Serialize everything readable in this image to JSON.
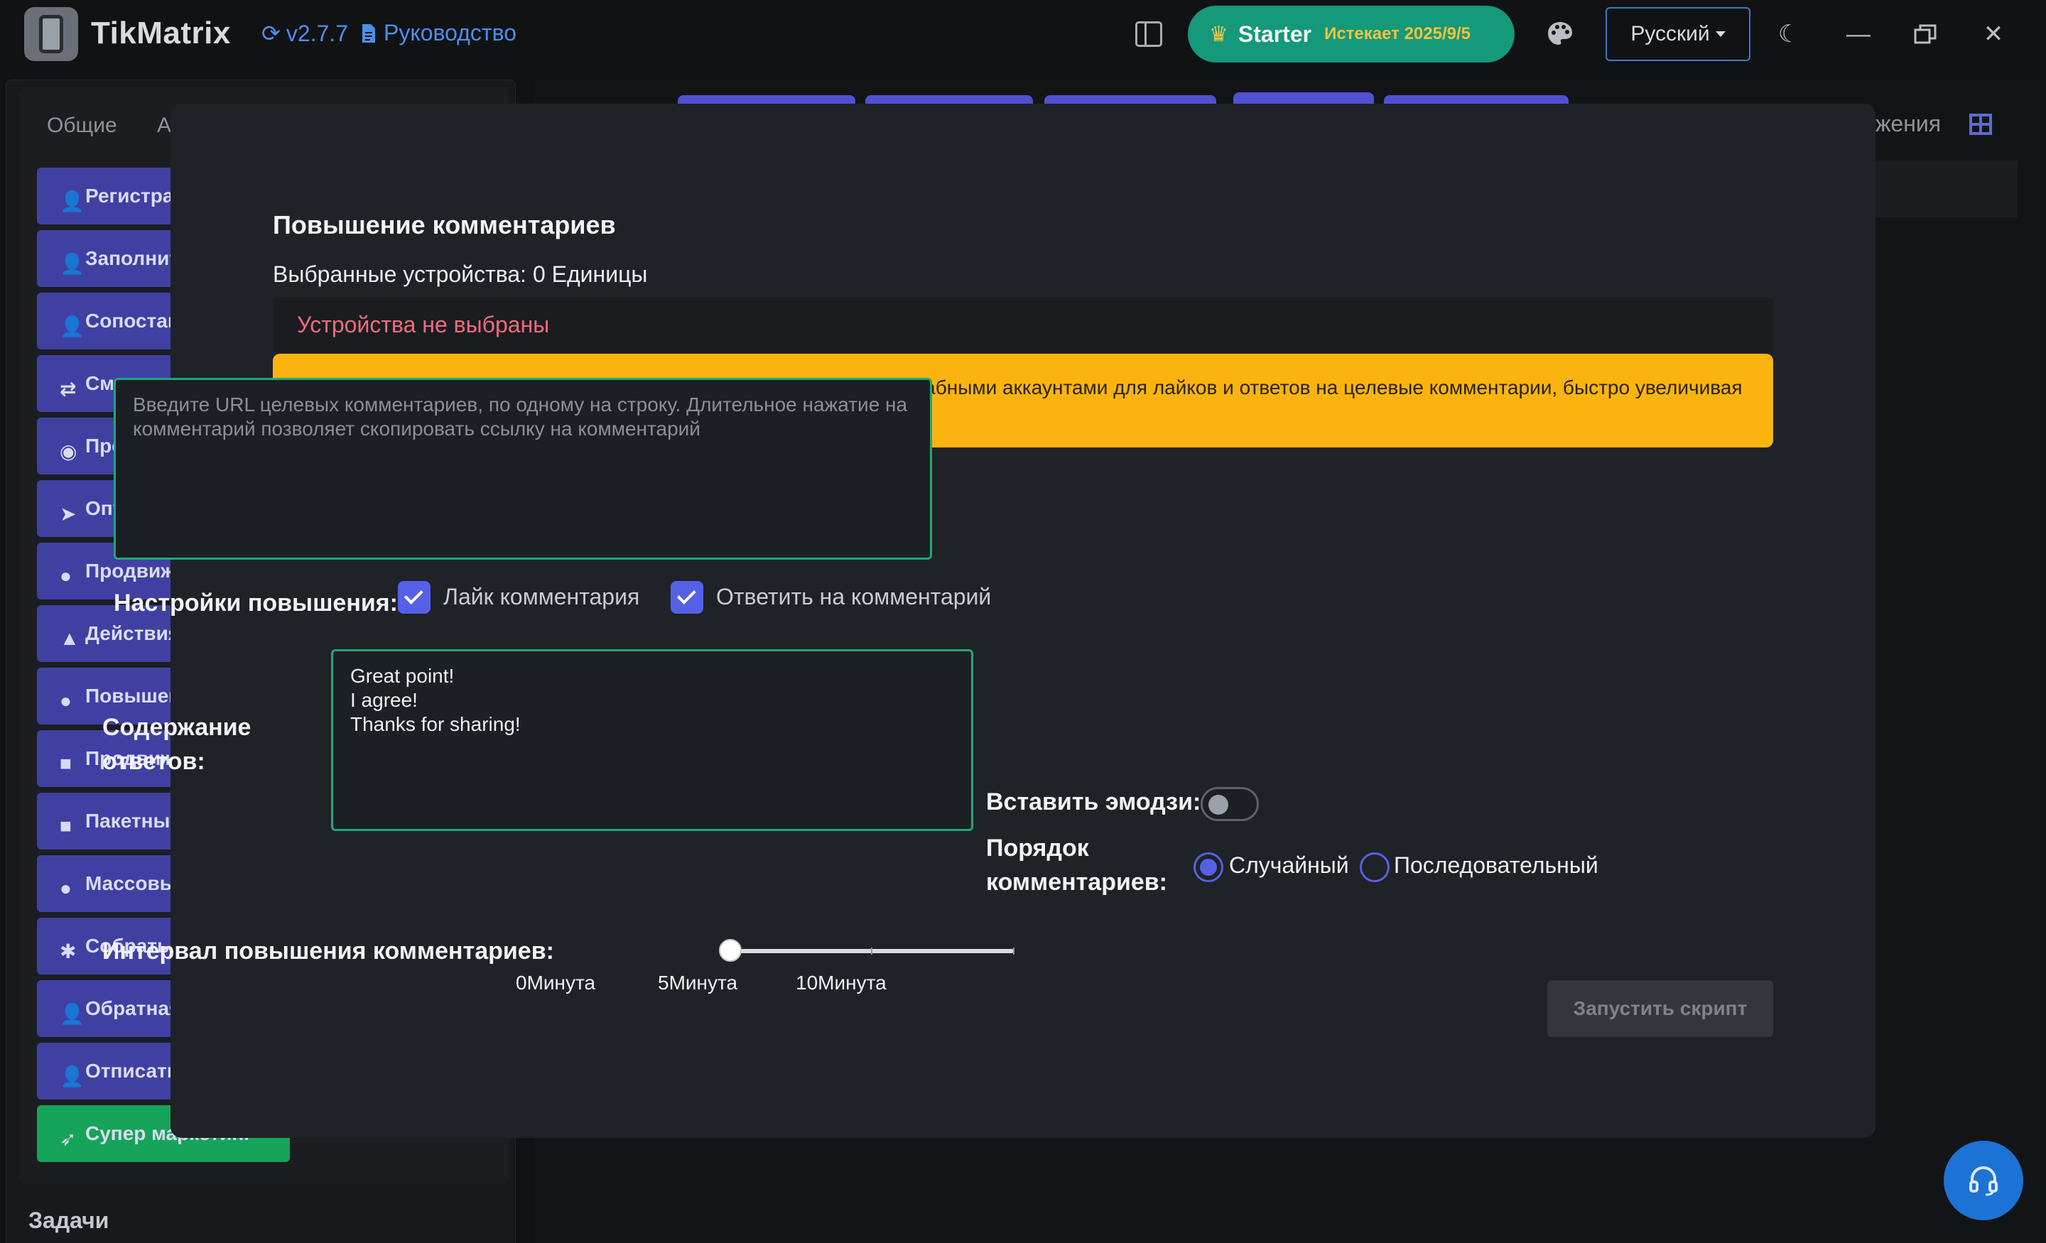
{
  "titlebar": {
    "app_name": "TikMatrix",
    "version": "v2.7.7",
    "guide_link": "Руководство",
    "plan_name": "Starter",
    "plan_expiry": "Истекает 2025/9/5",
    "language": "Русский",
    "accent_color": "#14997a"
  },
  "left_panel": {
    "tabs": [
      "Общие",
      "AD"
    ],
    "menu_items": [
      {
        "label": "Регистрация",
        "icon": "user-plus-icon"
      },
      {
        "label": "Заполнить профиль",
        "icon": "user-plus-icon"
      },
      {
        "label": "Сопоставить",
        "icon": "user-plus-icon"
      },
      {
        "label": "Сменить",
        "icon": "swap-icon"
      },
      {
        "label": "Прогрев",
        "icon": "eye-icon"
      },
      {
        "label": "Опубликовать",
        "icon": "send-icon"
      },
      {
        "label": "Продвижение",
        "icon": "user-icon"
      },
      {
        "label": "Действия",
        "icon": "thumbs-up-icon"
      },
      {
        "label": "Повышение",
        "icon": "comment-icon"
      },
      {
        "label": "Продвижение",
        "icon": "video-icon"
      },
      {
        "label": "Пакетные",
        "icon": "message-icon"
      },
      {
        "label": "Массовые",
        "icon": "comment-icon"
      },
      {
        "label": "Собрать",
        "icon": "spider-icon"
      },
      {
        "label": "Обратная",
        "icon": "user-plus-icon"
      },
      {
        "label": "Отписаться",
        "icon": "user-minus-icon"
      },
      {
        "label": "Супер маркетинг",
        "icon": "rocket-icon"
      }
    ],
    "tasks_title": "Задачи"
  },
  "right_panel": {
    "partial_label": "жения"
  },
  "modal": {
    "title": "Повышение комментариев",
    "selected_devices": "Выбранные устройства: 0 Единицы",
    "no_devices": "Устройства не выбраны",
    "warning_text": "Функция повышения комментариев позволяет управлять масштабными аккаунтами для лайков и ответов на целевые комментарии, быстро увеличивая взаимодействие и вовлеченность для целевых комментариев.",
    "url_placeholder": "Введите URL целевых комментариев, по одному на строку. Длительное нажатие на комментарий позволяет скопировать ссылку на комментарий",
    "settings_label": "Настройки повышения:",
    "like_label": "Лайк комментария",
    "like_checked": true,
    "reply_label": "Ответить на комментарий",
    "reply_checked": true,
    "reply_content_label": "Содержание ответов:",
    "reply_content": "Great point!\nI agree!\nThanks for sharing!",
    "emoji_label": "Вставить эмодзи:",
    "emoji_enabled": false,
    "order_label": "Порядок комментариев:",
    "order_random": "Случайный",
    "order_sequential": "Последовательный",
    "order_selected": "random",
    "interval_label": "Интервал повышения комментариев:",
    "interval_value_minutes": 0,
    "interval_marks": [
      "0Минута",
      "5Минута",
      "10Минута"
    ],
    "run_button": "Запустить скрипт"
  }
}
